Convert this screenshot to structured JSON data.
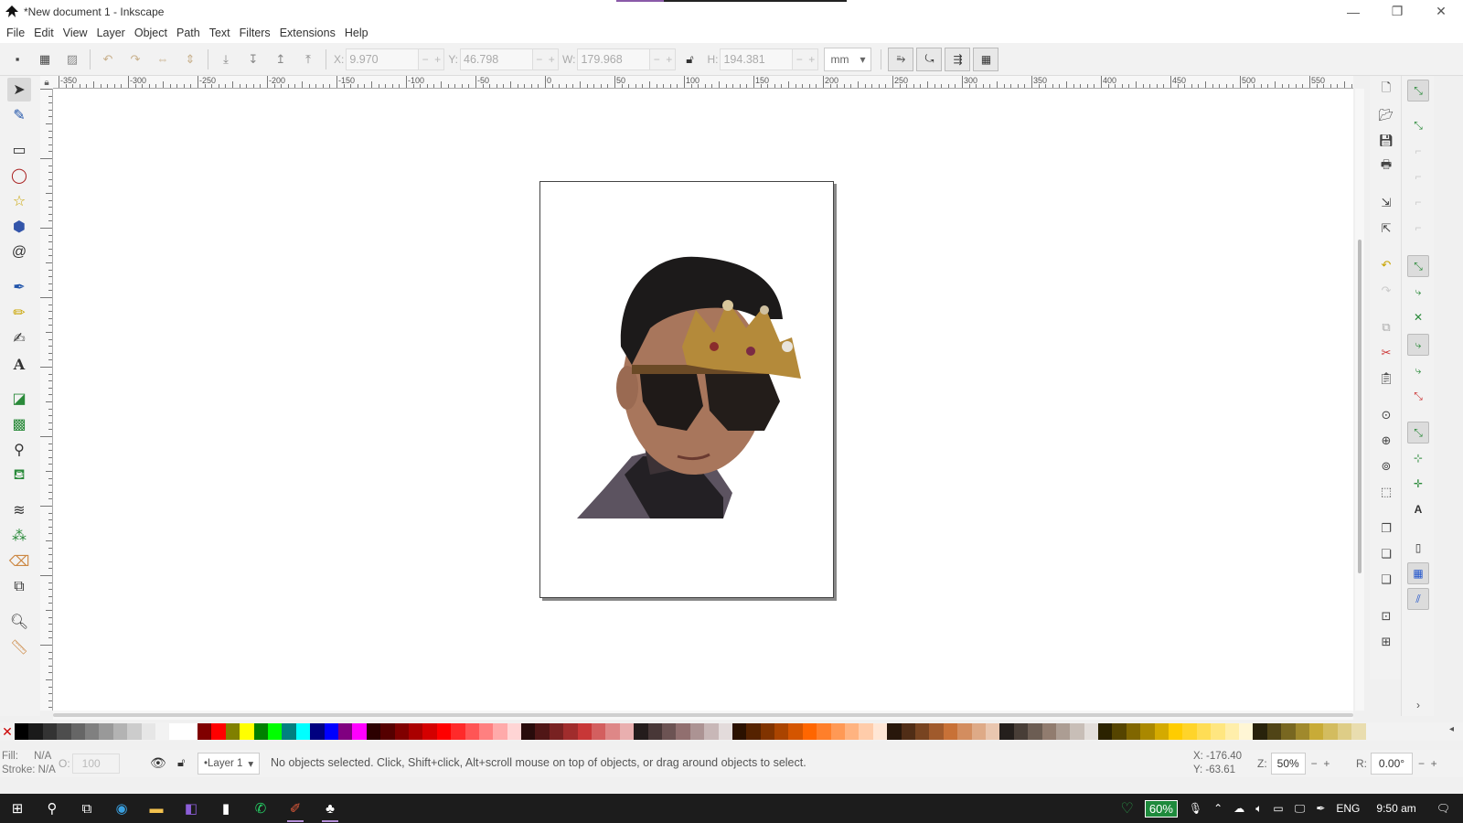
{
  "window": {
    "title": "*New document 1 - Inkscape",
    "minimize": "—",
    "restore": "❐",
    "close": "✕"
  },
  "menu": [
    "File",
    "Edit",
    "View",
    "Layer",
    "Object",
    "Path",
    "Text",
    "Filters",
    "Extensions",
    "Help"
  ],
  "controls": {
    "x_label": "X:",
    "x_value": "9.970",
    "y_label": "Y:",
    "y_value": "46.798",
    "w_label": "W:",
    "w_value": "179.968",
    "h_label": "H:",
    "h_value": "194.381",
    "unit": "mm"
  },
  "ruler_labels": [
    "-350",
    "-300",
    "-250",
    "-200",
    "-150",
    "-100",
    "-50",
    "0",
    "50",
    "100",
    "150",
    "200",
    "250",
    "300",
    "350",
    "400",
    "450",
    "500",
    "550"
  ],
  "tools": [
    "selector-tool",
    "node-tool",
    "rectangle-tool",
    "ellipse-tool",
    "star-tool",
    "3dbox-tool",
    "spiral-tool",
    "bezier-tool",
    "pencil-tool",
    "calligraphy-tool",
    "text-tool",
    "gradient-tool",
    "mesh-tool",
    "dropper-tool",
    "paint-bucket-tool",
    "tweak-tool",
    "spray-tool",
    "eraser-tool",
    "connector-tool",
    "zoom-tool",
    "measure-tool"
  ],
  "palette_colors": [
    "#000000",
    "#1a1a1a",
    "#333333",
    "#4d4d4d",
    "#666666",
    "#808080",
    "#999999",
    "#b3b3b3",
    "#cccccc",
    "#e6e6e6",
    "#f2f2f2",
    "#ffffff",
    "#ffffff",
    "#800000",
    "#ff0000",
    "#808000",
    "#ffff00",
    "#008000",
    "#00ff00",
    "#008080",
    "#00ffff",
    "#000080",
    "#0000ff",
    "#800080",
    "#ff00ff",
    "#2b0000",
    "#550000",
    "#800000",
    "#aa0000",
    "#d40000",
    "#ff0000",
    "#ff2a2a",
    "#ff5555",
    "#ff8080",
    "#ffaaaa",
    "#ffd5d5",
    "#280b0b",
    "#501616",
    "#782121",
    "#a02c2c",
    "#c83737",
    "#d35f5f",
    "#de8787",
    "#e9afaf",
    "#241c1c",
    "#483737",
    "#6c5353",
    "#916f6f",
    "#ac9393",
    "#c8b7b7",
    "#e3dbdb",
    "#2b1100",
    "#552200",
    "#803300",
    "#aa4400",
    "#d45500",
    "#ff6600",
    "#ff7f2a",
    "#ff9955",
    "#ffb380",
    "#ffccaa",
    "#ffe6d5",
    "#28170b",
    "#502d16",
    "#784421",
    "#a05a2c",
    "#c87137",
    "#d38d5f",
    "#deaa87",
    "#e9c6af",
    "#241f1c",
    "#483e37",
    "#6c5d53",
    "#917c6f",
    "#ac9d93",
    "#c8beb7",
    "#e3dedb",
    "#2b2200",
    "#554400",
    "#806600",
    "#aa8800",
    "#d4aa00",
    "#ffcc00",
    "#ffd42a",
    "#ffdd55",
    "#ffe680",
    "#ffeeaa",
    "#fff6d5",
    "#28220b",
    "#504416",
    "#786721",
    "#a0892c",
    "#c8ab37",
    "#d3bc5f",
    "#decd87",
    "#e9ddaf"
  ],
  "status": {
    "fill_label": "Fill:",
    "fill_value": "N/A",
    "stroke_label": "Stroke:",
    "stroke_value": "N/A",
    "opacity_label": "O:",
    "opacity_value": "100",
    "layer": "•Layer 1",
    "message": "No objects selected. Click, Shift+click, Alt+scroll mouse on top of objects, or drag around objects to select.",
    "cursor_x": "X: -176.40",
    "cursor_y": "Y: -63.61",
    "zoom_label": "Z:",
    "zoom_value": "50%",
    "rotation_label": "R:",
    "rotation_value": "0.00°"
  },
  "taskbar": {
    "battery": "60%",
    "language": "ENG",
    "time": "9:50 am"
  }
}
